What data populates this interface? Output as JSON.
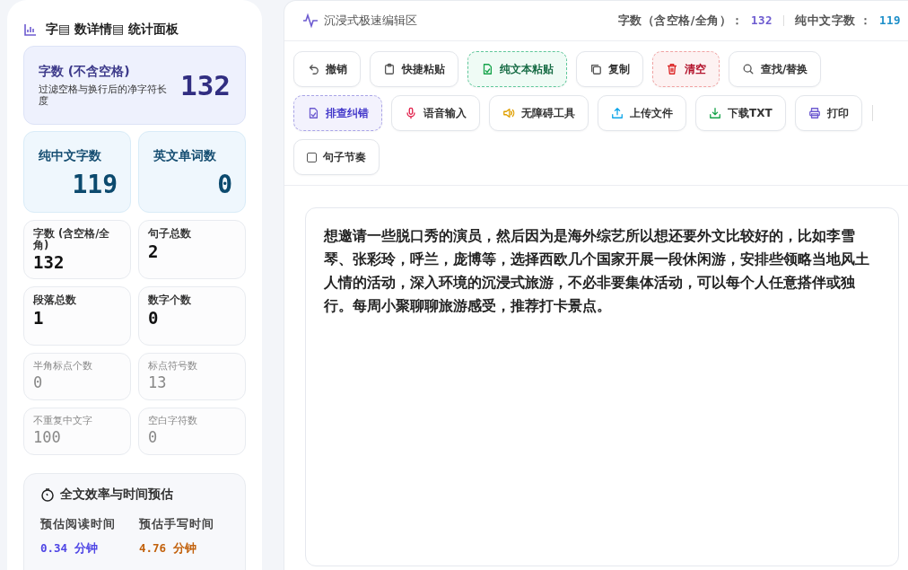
{
  "sidebar": {
    "title": "字▤ 数详情▤ 统计面板",
    "hero": {
      "label": "字数 (不含空格)",
      "note": "过滤空格与换行后的净字符长度",
      "value": "132"
    },
    "stats": [
      {
        "kind": "accent",
        "label": "纯中文字数",
        "value": "119"
      },
      {
        "kind": "accent",
        "label": "英文单词数",
        "value": "0"
      },
      {
        "kind": "normal",
        "label": "字数 (含空格/全角)",
        "value": "132"
      },
      {
        "kind": "normal",
        "label": "句子总数",
        "value": "2"
      },
      {
        "kind": "normal",
        "label": "段落总数",
        "value": "1"
      },
      {
        "kind": "normal",
        "label": "数字个数",
        "value": "0"
      },
      {
        "kind": "muted",
        "label": "半角标点个数",
        "value": "0"
      },
      {
        "kind": "muted",
        "label": "标点符号数",
        "value": "13"
      },
      {
        "kind": "muted",
        "label": "不重复中文字",
        "value": "100"
      },
      {
        "kind": "muted",
        "label": "空白字符数",
        "value": "0"
      }
    ],
    "timing": {
      "title": "全文效率与时间预估",
      "items": [
        {
          "label": "预估阅读时间",
          "value": "0.34",
          "unit": "分钟",
          "color": "#4f46e5"
        },
        {
          "label": "预估手写时间",
          "value": "4.76",
          "unit": "分钟",
          "color": "#c2610c"
        }
      ]
    }
  },
  "editor": {
    "title": "沉浸式极速编辑区",
    "counters": [
      {
        "label": "字数（含空格/全角）：",
        "value": "132",
        "color": "#6d5bd0"
      },
      {
        "label": "纯中文字数 ：",
        "value": "119",
        "color": "#1d8fc9"
      }
    ],
    "toolbar": [
      {
        "kind": "plain",
        "label": "撤销"
      },
      {
        "kind": "plain",
        "label": "快捷粘贴"
      },
      {
        "kind": "success",
        "label": "纯文本粘贴"
      },
      {
        "kind": "plain",
        "label": "复制"
      },
      {
        "kind": "danger",
        "label": "清空"
      },
      {
        "kind": "plain",
        "label": "查找/替换"
      },
      {
        "kind": "primary",
        "label": "排查纠错"
      },
      {
        "kind": "plain",
        "label": "语音输入"
      },
      {
        "kind": "plain",
        "label": "无障碍工具"
      },
      {
        "kind": "plain",
        "label": "上传文件"
      },
      {
        "kind": "plain",
        "label": "下载TXT"
      },
      {
        "kind": "plain",
        "label": "打印"
      },
      {
        "kind": "checkbox",
        "label": "句子节奏",
        "checked": false
      }
    ],
    "text": "想邀请一些脱口秀的演员，然后因为是海外综艺所以想还要外文比较好的，比如李雪琴、张彩玲，呼兰，庞博等，选择西欧几个国家开展一段休闲游，安排些领略当地风土人情的活动，深入环境的沉浸式旅游，不必非要集体活动，可以每个人任意搭伴或独行。每周小聚聊聊旅游感受，推荐打卡景点。"
  }
}
